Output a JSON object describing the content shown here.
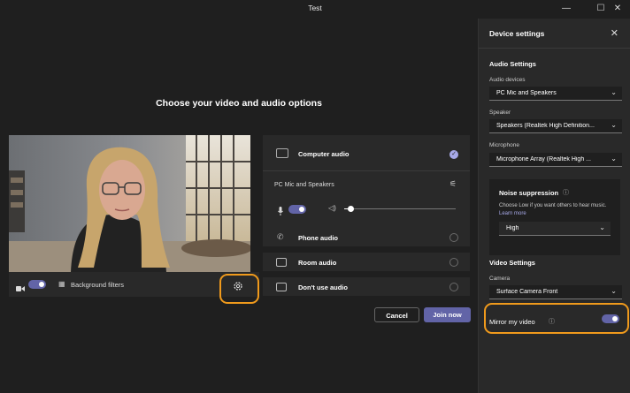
{
  "window": {
    "title": "Test"
  },
  "main": {
    "heading": "Choose your video and audio options",
    "video_bar": {
      "background_filters": "Background filters"
    },
    "audio": {
      "computer_audio": "Computer audio",
      "device_label": "PC Mic and Speakers",
      "phone_audio": "Phone audio",
      "room_audio": "Room audio",
      "dont_use_audio": "Don't use audio"
    },
    "buttons": {
      "cancel": "Cancel",
      "join_now": "Join now"
    }
  },
  "device_settings": {
    "title": "Device settings",
    "audio_settings": "Audio Settings",
    "audio_devices_label": "Audio devices",
    "audio_devices_value": "PC Mic and Speakers",
    "speaker_label": "Speaker",
    "speaker_value": "Speakers (Realtek High Definition...",
    "microphone_label": "Microphone",
    "microphone_value": "Microphone Array (Realtek High ...",
    "noise_title": "Noise suppression",
    "noise_desc": "Choose Low if you want others to hear music.",
    "noise_link": "Learn more",
    "noise_value": "High",
    "video_settings": "Video Settings",
    "camera_label": "Camera",
    "camera_value": "Surface Camera Front",
    "mirror_label": "Mirror my video"
  },
  "colors": {
    "accent": "#6264a7",
    "highlight": "#f09a1c",
    "panel": "#292929",
    "background": "#1f1f1f"
  },
  "icons": [
    "minimize-icon",
    "maximize-icon",
    "close-icon",
    "camera-icon",
    "background-filter-icon",
    "gear-icon",
    "computer-audio-icon",
    "sliders-icon",
    "mic-icon",
    "speaker-icon",
    "phone-icon",
    "room-icon",
    "no-audio-icon",
    "info-icon",
    "chevron-down-icon"
  ]
}
